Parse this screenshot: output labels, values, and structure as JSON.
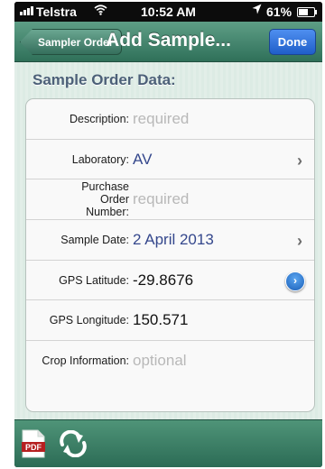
{
  "status_bar": {
    "carrier": "Telstra",
    "time": "10:52 AM",
    "battery_percent": "61%",
    "battery_level": 0.61,
    "icons": [
      "signal-bars-icon",
      "wifi-icon",
      "location-arrow-icon",
      "battery-icon"
    ]
  },
  "nav": {
    "back_label": "Sampler Order",
    "title": "Add Sample...",
    "done_label": "Done"
  },
  "section": {
    "header": "Sample Order Data:"
  },
  "rows": [
    {
      "label": "Description:",
      "value": "required",
      "value_style": "placeholder",
      "accessory": "none"
    },
    {
      "label": "Laboratory:",
      "value": "AV",
      "value_style": "blue",
      "accessory": "chevron"
    },
    {
      "label": "Purchase Order Number:",
      "value": "required",
      "value_style": "placeholder",
      "accessory": "none"
    },
    {
      "label": "Sample Date:",
      "value": "2 April 2013",
      "value_style": "blue",
      "accessory": "chevron"
    },
    {
      "label": "GPS Latitude:",
      "value": "-29.8676",
      "value_style": "dark",
      "accessory": "detail-disclosure"
    },
    {
      "label": "GPS Longitude:",
      "value": "150.571",
      "value_style": "dark",
      "accessory": "none"
    },
    {
      "label": "Crop Information:",
      "value": "optional",
      "value_style": "placeholder",
      "accessory": "none"
    }
  ],
  "toolbar": {
    "pdf_label": "PDF",
    "icons": [
      "pdf-icon",
      "refresh-icon"
    ]
  },
  "colors": {
    "nav_green": "#2f7059",
    "section_header": "#4c6078",
    "value_blue": "#34478c",
    "done_blue": "#1f5ec9"
  }
}
